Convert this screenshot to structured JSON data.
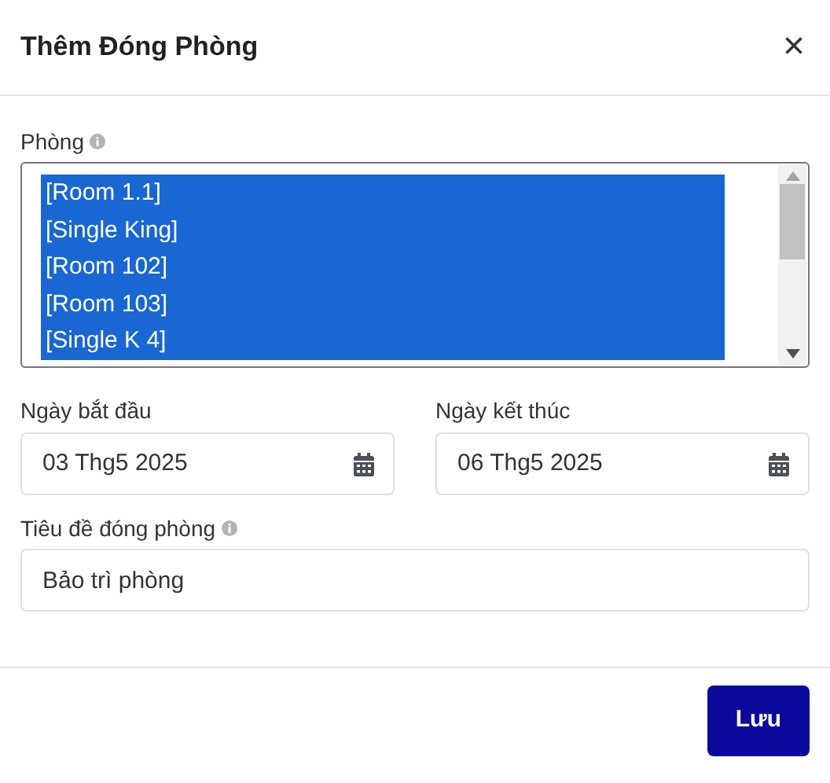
{
  "dialog": {
    "title": "Thêm Đóng Phòng",
    "close": "×"
  },
  "rooms": {
    "label": "Phòng",
    "info": true,
    "options": [
      {
        "label": "[Room 1.1]",
        "selected": true
      },
      {
        "label": "[Single King]",
        "selected": true
      },
      {
        "label": "[Room 102]",
        "selected": true
      },
      {
        "label": "[Room 103]",
        "selected": true
      },
      {
        "label": "[Single K 4]",
        "selected": true
      }
    ]
  },
  "start_date": {
    "label": "Ngày bắt đầu",
    "value": "03 Thg5 2025"
  },
  "end_date": {
    "label": "Ngày kết thúc",
    "value": "06 Thg5 2025"
  },
  "closure_title": {
    "label": "Tiêu đề đóng phòng",
    "info": true,
    "value": "Bảo trì phòng"
  },
  "buttons": [
    {
      "label": "Lưu"
    }
  ]
}
